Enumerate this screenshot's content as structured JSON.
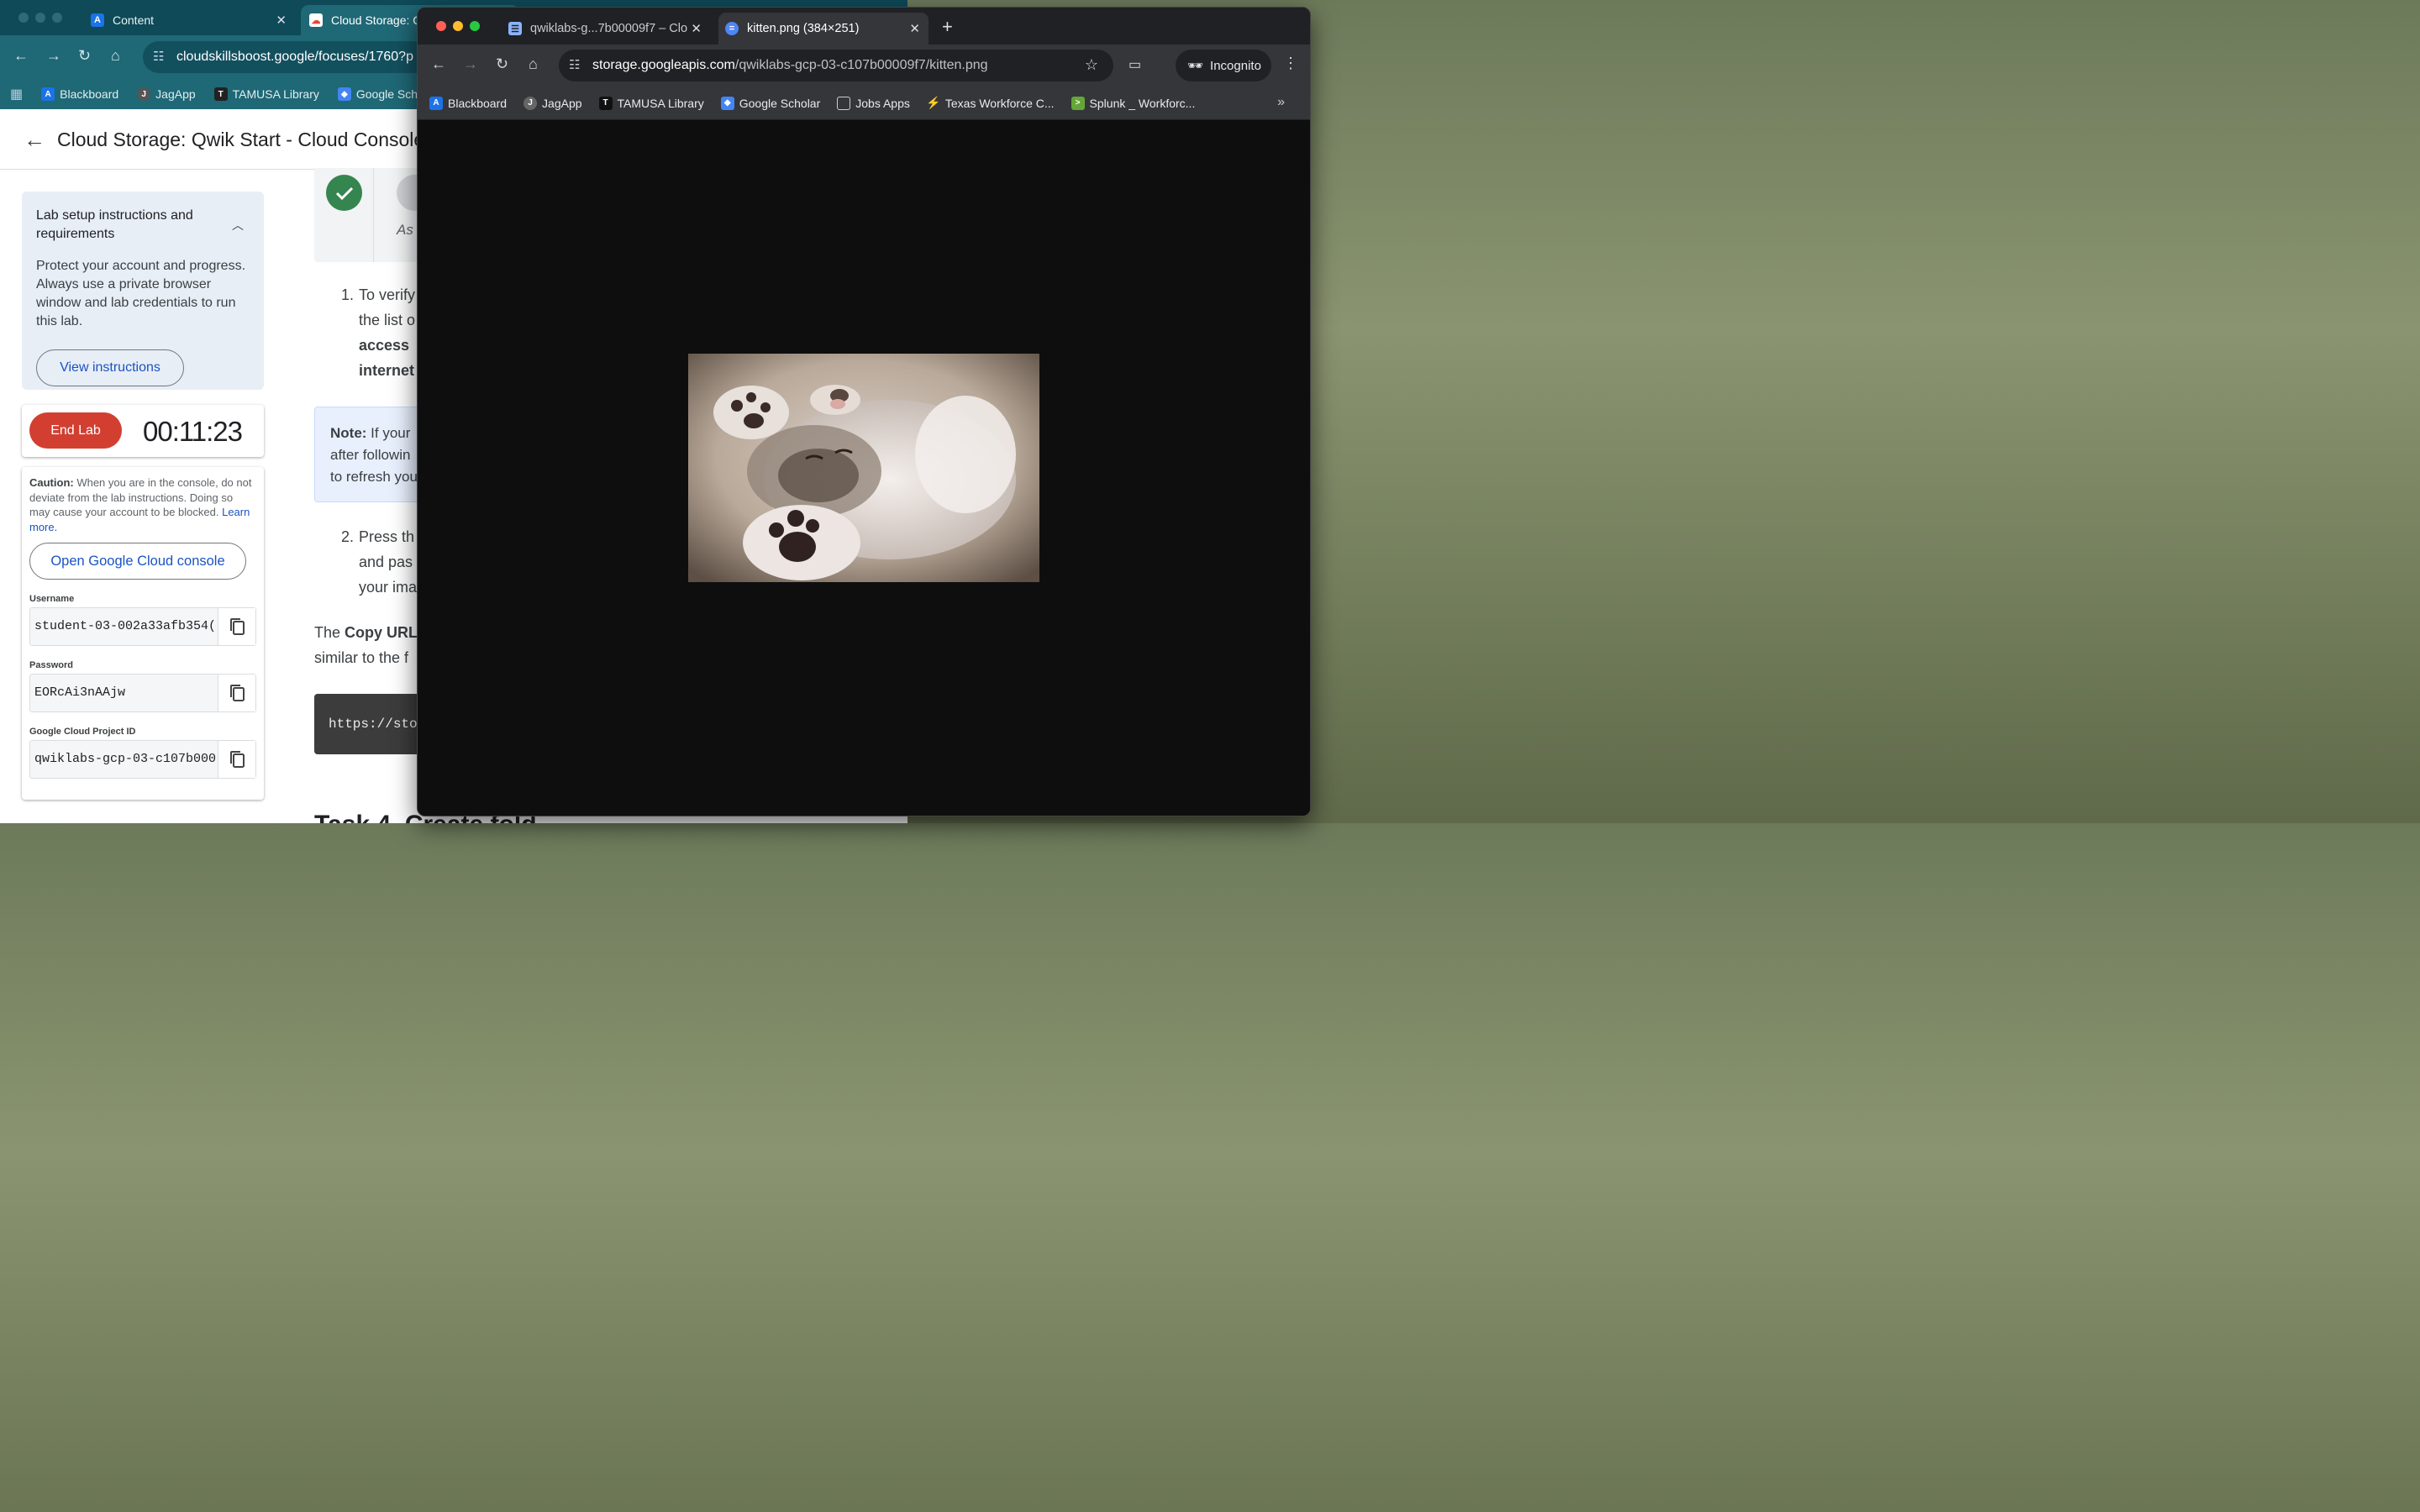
{
  "back_window": {
    "tabs": [
      {
        "label": "Content"
      },
      {
        "label": "Cloud Storage: Q"
      }
    ],
    "url": "cloudskillsboost.google/focuses/1760?p",
    "bookmarks": [
      "Blackboard",
      "JagApp",
      "TAMUSA Library",
      "Google Sch"
    ],
    "page_title": "Cloud Storage: Qwik Start - Cloud Console",
    "setup": {
      "title": "Lab setup instructions and requirements",
      "body": "Protect your account and progress. Always use a private browser window and lab credentials to run this lab.",
      "button": "View instructions"
    },
    "end_lab": "End Lab",
    "timer": "00:11:23",
    "caution_label": "Caution:",
    "caution_text": " When you are in the console, do not deviate from the lab instructions. Doing so may cause your account to be blocked.",
    "learn_more": "Learn more.",
    "open_console": "Open Google Cloud console",
    "credentials": [
      {
        "label": "Username",
        "value": "student-03-002a33afb354("
      },
      {
        "label": "Password",
        "value": "EORcAi3nAAjw"
      },
      {
        "label": "Google Cloud Project ID",
        "value": "qwiklabs-gcp-03-c107b000"
      }
    ],
    "stepper_text": "As",
    "step1_lines": [
      "To verify",
      "the list o",
      "access",
      "internet"
    ],
    "step1_num": "1.",
    "note_label": "Note:",
    "note_lines": [
      " If your",
      "after followin",
      "to refresh you"
    ],
    "step2_num": "2.",
    "step2_lines": [
      "Press th",
      "and pas",
      "your ima"
    ],
    "para_prefix": "The ",
    "para_bold": "Copy URL",
    "para_line2": "similar to the f",
    "code": "https://stor",
    "task_heading": "Task 4. Create fold"
  },
  "front_window": {
    "tabs": [
      {
        "label": "qwiklabs-g...7b00009f7 – Clo"
      },
      {
        "label": "kitten.png (384×251)"
      }
    ],
    "url_host": "storage.googleapis.com",
    "url_path": "/qwiklabs-gcp-03-c107b00009f7/kitten.png",
    "incognito_label": "Incognito",
    "bookmarks": [
      "Blackboard",
      "JagApp",
      "TAMUSA Library",
      "Google Scholar",
      "Jobs Apps",
      "Texas Workforce C...",
      "Splunk _ Workforc..."
    ]
  },
  "colors": {
    "back_chrome": "#1f6876",
    "front_chrome": "#35363a",
    "end_lab": "#d23f31",
    "check": "#34854f",
    "link": "#1a53c2"
  }
}
